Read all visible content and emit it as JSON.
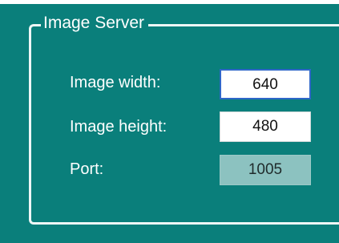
{
  "group": {
    "title": "Image Server"
  },
  "fields": {
    "width": {
      "label": "Image width:",
      "value": "640"
    },
    "height": {
      "label": "Image height:",
      "value": "480"
    },
    "port": {
      "label": "Port:",
      "value": "1005"
    }
  },
  "colors": {
    "background": "#0a7f7b",
    "text": "#ffffff",
    "focus_border": "#2e67c8",
    "disabled_field": "#8cc2c0"
  }
}
